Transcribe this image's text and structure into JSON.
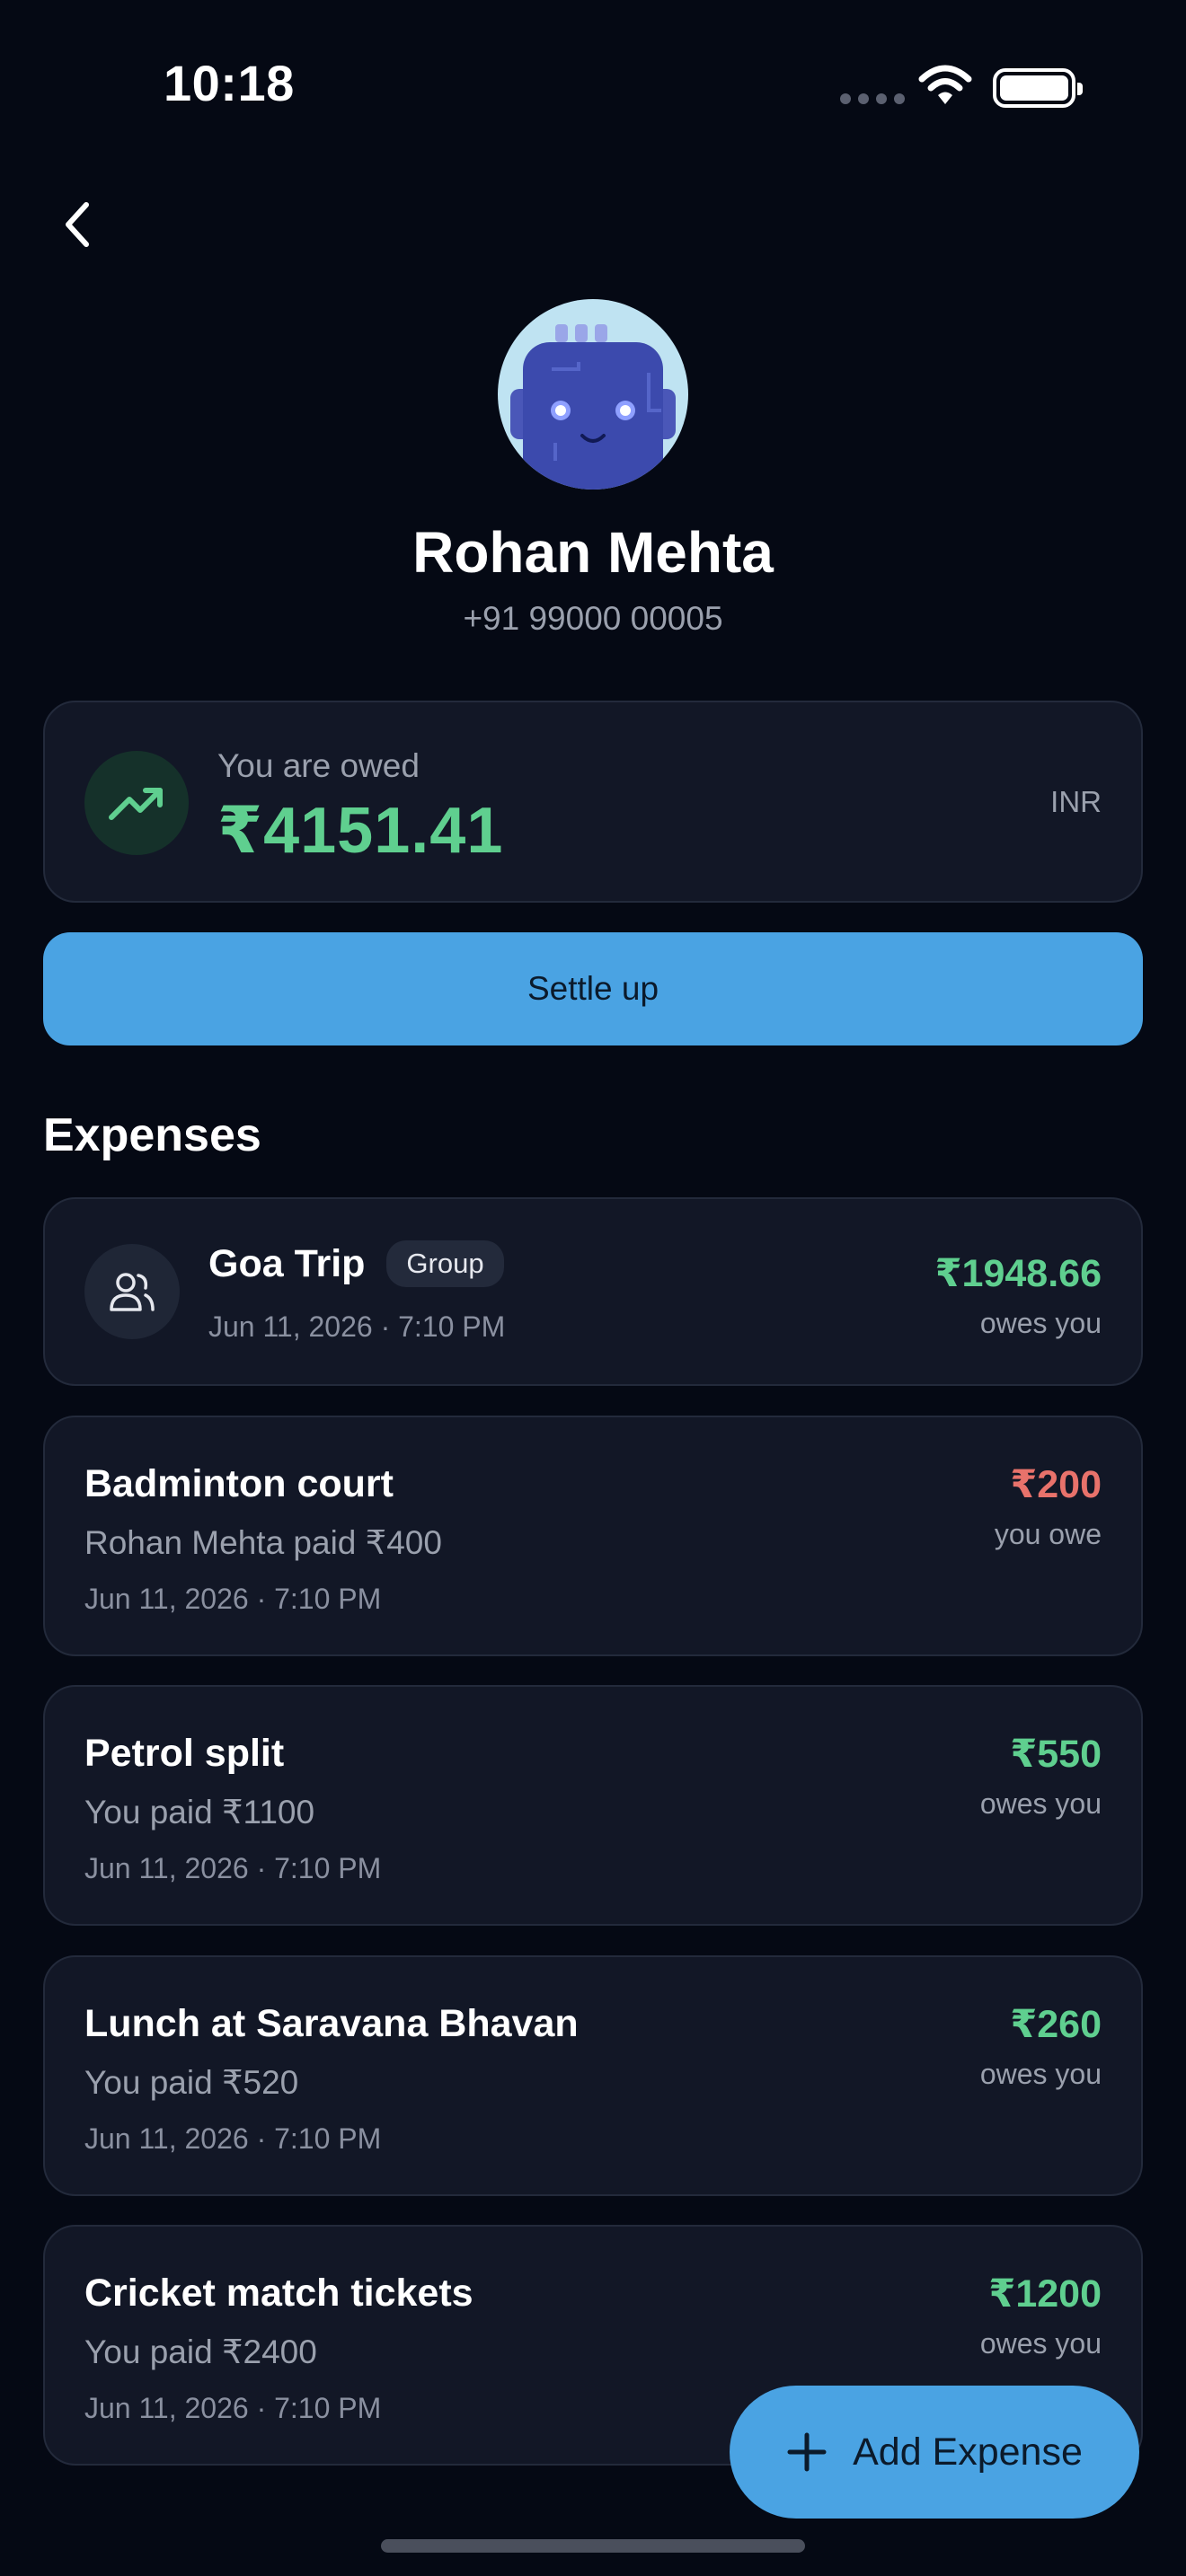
{
  "status_bar": {
    "time": "10:18"
  },
  "profile": {
    "name": "Rohan Mehta",
    "phone": "+91 99000 00005"
  },
  "balance": {
    "label": "You are owed",
    "amount": "₹4151.41",
    "currency": "INR"
  },
  "settle_label": "Settle up",
  "expenses_title": "Expenses",
  "expenses": [
    {
      "title": "Goa Trip",
      "badge": "Group",
      "date": "Jun 11, 2026 · 7:10 PM",
      "amount": "₹1948.66",
      "note": "owes you",
      "status": "owed"
    },
    {
      "title": "Badminton court",
      "subtitle": "Rohan Mehta paid ₹400",
      "date": "Jun 11, 2026 · 7:10 PM",
      "amount": "₹200",
      "note": "you owe",
      "status": "owe"
    },
    {
      "title": "Petrol split",
      "subtitle": "You paid ₹1100",
      "date": "Jun 11, 2026 · 7:10 PM",
      "amount": "₹550",
      "note": "owes you",
      "status": "owed"
    },
    {
      "title": "Lunch at Saravana Bhavan",
      "subtitle": "You paid ₹520",
      "date": "Jun 11, 2026 · 7:10 PM",
      "amount": "₹260",
      "note": "owes you",
      "status": "owed"
    },
    {
      "title": "Cricket match tickets",
      "subtitle": "You paid ₹2400",
      "date": "Jun 11, 2026 · 7:10 PM",
      "amount": "₹1200",
      "note": "owes you",
      "status": "owed"
    }
  ],
  "fab_label": "Add Expense",
  "colors": {
    "background": "#050914",
    "card": "#121726",
    "accent": "#4aa3e3",
    "positive": "#5fcf8f",
    "negative": "#e8726b"
  },
  "icons": [
    "back-chevron-icon",
    "trending-up-icon",
    "group-people-icon",
    "plus-icon",
    "wifi-icon",
    "battery-icon"
  ]
}
